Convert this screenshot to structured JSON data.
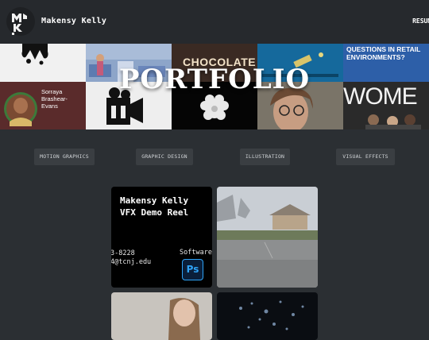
{
  "header": {
    "site_name": "Makensy Kelly",
    "nav_resume": "RESUME",
    "logo_letters": "MK"
  },
  "hero": {
    "title": "PORTFOLIO",
    "tiles": {
      "chocolate_text": "CHOCOLATE",
      "questions_text": "QUESTIONS IN RETAIL ENVIRONMENTS?",
      "person_name": "Sorraya Brashear-Evans",
      "women_text": "WOME"
    }
  },
  "filters": [
    "MOTION GRAPHICS",
    "GRAPHIC DESIGN",
    "ILLUSTRATION",
    "VISUAL EFFECTS"
  ],
  "gallery": {
    "reel": {
      "title": "Makensy Kelly\nVFX Demo Reel",
      "phone_fragment": "3-8228",
      "email_fragment": "4@tcnj.edu",
      "software_fragment": "Software",
      "ps_icon": "Ps"
    }
  },
  "colors": {
    "background": "#2b2f33",
    "header": "#26292d",
    "filter_button": "#3a3e42",
    "photoshop_blue": "#2fa3f7"
  }
}
